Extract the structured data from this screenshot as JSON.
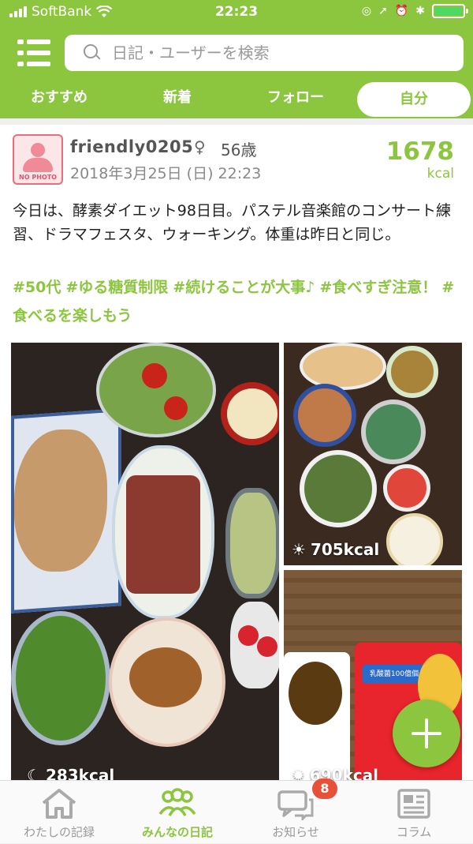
{
  "status_bar": {
    "carrier": "SoftBank",
    "time": "22:23"
  },
  "search": {
    "placeholder": "日記・ユーザーを検索"
  },
  "tabs": [
    {
      "label": "おすすめ",
      "active": false
    },
    {
      "label": "新着",
      "active": false
    },
    {
      "label": "フォロー",
      "active": false
    },
    {
      "label": "自分",
      "active": true
    }
  ],
  "post": {
    "avatar_text": "NO PHOTO",
    "username": "friendly0205",
    "gender_symbol": "♀",
    "age": "56歳",
    "datetime": "2018年3月25日 (日) 22:23",
    "total_kcal": "1678",
    "kcal_unit": "kcal",
    "text": "今日は、酵素ダイエット98日目。パステル音楽館のコンサート練習、ドラマフェスタ、ウォーキング。体重は昨日と同じ。",
    "tags": [
      "#50代",
      "#ゆる糖質制限",
      "#続けることが大事♪",
      "#食べすぎ注意！",
      "#食べるを楽しもう"
    ],
    "photos": [
      {
        "meal": "dinner",
        "icon": "moon-icon",
        "kcal": "283kcal"
      },
      {
        "meal": "breakfast",
        "icon": "sunrise-icon",
        "kcal": "705kcal"
      },
      {
        "meal": "lunch",
        "icon": "sun-icon",
        "kcal": "690kcal"
      }
    ],
    "package_text": "乳酸菌100億個"
  },
  "bottom_nav": [
    {
      "label": "わたしの記録",
      "icon": "house-icon",
      "active": false
    },
    {
      "label": "みんなの日記",
      "icon": "people-icon",
      "active": true
    },
    {
      "label": "お知らせ",
      "icon": "chat-bubbles-icon",
      "active": false
    },
    {
      "label": "コラム",
      "icon": "newspaper-icon",
      "active": false
    }
  ],
  "notification_count": "8",
  "colors": {
    "brand_green": "#8cc63f",
    "badge_red": "#e8503a"
  }
}
